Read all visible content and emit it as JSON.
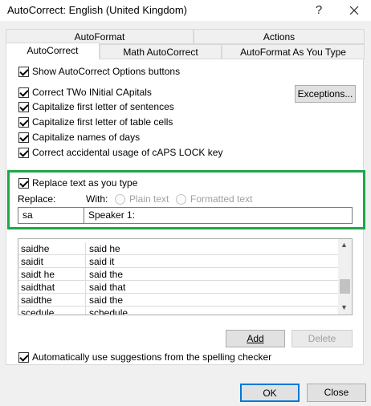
{
  "window": {
    "title": "AutoCorrect: English (United Kingdom)",
    "help_glyph": "?",
    "close_glyph": "✕"
  },
  "tabs": {
    "row1": [
      {
        "label": "AutoFormat"
      },
      {
        "label": "Actions"
      }
    ],
    "row2": [
      {
        "label": "AutoCorrect",
        "active": true
      },
      {
        "label": "Math AutoCorrect"
      },
      {
        "label": "AutoFormat As You Type"
      }
    ]
  },
  "options": {
    "show_buttons": {
      "label": "Show AutoCorrect Options buttons",
      "checked": true
    },
    "two_initial_caps": {
      "label": "Correct TWo INitial CApitals",
      "checked": true
    },
    "cap_sentences": {
      "label": "Capitalize first letter of sentences",
      "checked": true
    },
    "cap_table_cells": {
      "label": "Capitalize first letter of table cells",
      "checked": true
    },
    "cap_days": {
      "label": "Capitalize names of days",
      "checked": true
    },
    "caps_lock": {
      "label": "Correct accidental usage of cAPS LOCK key",
      "checked": true
    },
    "exceptions_label": "Exceptions..."
  },
  "replace": {
    "checkbox_label": "Replace text as you type",
    "checked": true,
    "replace_label": "Replace:",
    "with_label": "With:",
    "plain_text_label": "Plain text",
    "formatted_text_label": "Formatted text",
    "replace_value": "sa",
    "with_value": "Speaker 1:"
  },
  "list": {
    "rows": [
      {
        "replace": "saidhe",
        "with": "said he"
      },
      {
        "replace": "saidit",
        "with": "said it"
      },
      {
        "replace": "saidt he",
        "with": "said the"
      },
      {
        "replace": "saidthat",
        "with": "said that"
      },
      {
        "replace": "saidthe",
        "with": "said the"
      },
      {
        "replace": "scedule",
        "with": "schedule"
      }
    ],
    "scroll_up": "▲",
    "scroll_down": "▼"
  },
  "actions": {
    "add_label": "Add",
    "delete_label": "Delete"
  },
  "spelling": {
    "label": "Automatically use suggestions from the spelling checker",
    "checked": true
  },
  "footer": {
    "ok_label": "OK",
    "close_label": "Close"
  },
  "colors": {
    "highlight_box": "#1fa64a",
    "ok_border": "#0078d7"
  }
}
